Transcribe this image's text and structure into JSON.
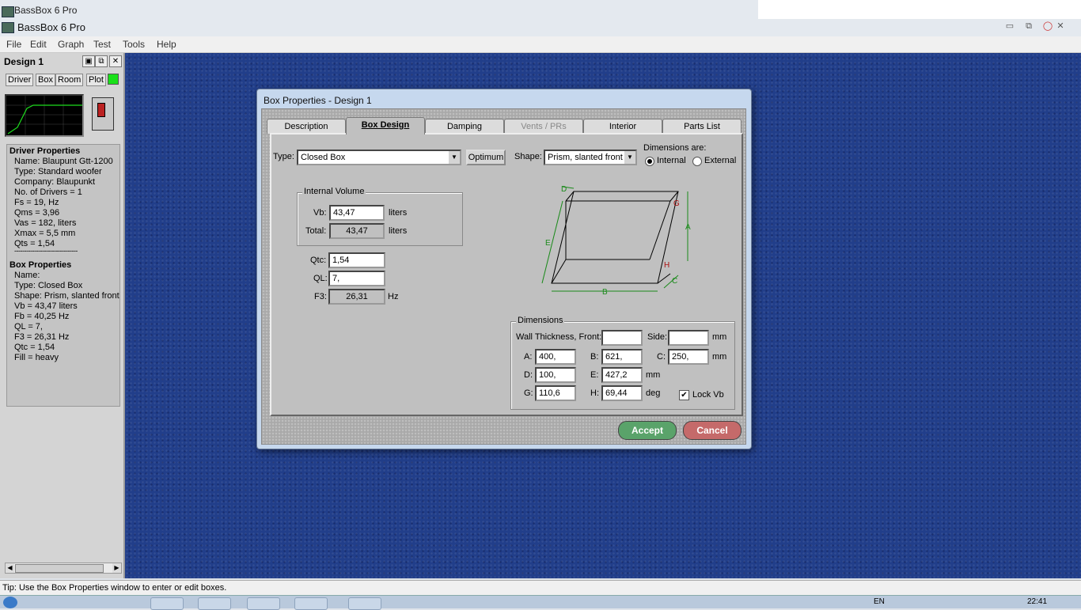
{
  "app": {
    "title_top": "BassBox 6 Pro",
    "title": "BassBox 6 Pro"
  },
  "menu": [
    "File",
    "Edit",
    "Graph",
    "Test",
    "Tools",
    "Help"
  ],
  "left_panel": {
    "title": "Design 1",
    "tabs": [
      "Driver",
      "Box",
      "Room",
      "Plot"
    ],
    "driver_heading": "Driver Properties",
    "driver_lines": [
      "Name: Blaupunt Gtt-1200",
      "Type: Standard woofer",
      "Company: Blaupunkt",
      "No. of Drivers = 1",
      "Fs = 19, Hz",
      "Qms = 3,96",
      "Vas = 182, liters",
      "Xmax = 5,5 mm",
      "Qts = 1,54"
    ],
    "separator": "--------------------------------",
    "box_heading": "Box Properties",
    "box_lines": [
      "Name:",
      "Type: Closed Box",
      "Shape: Prism, slanted front",
      "Vb = 43,47 liters",
      "Fb = 40,25 Hz",
      "QL = 7,",
      "F3 = 26,31 Hz",
      "Qtc = 1,54",
      "Fill = heavy"
    ]
  },
  "status": "Tip: Use the Box Properties window to enter or edit boxes.",
  "dialog": {
    "title": "Box Properties - Design 1",
    "tabs": [
      "Description",
      "Box Design",
      "Damping",
      "Vents / PRs",
      "Interior",
      "Parts List"
    ],
    "type_label": "Type:",
    "type_value": "Closed Box",
    "optimum_label": "Optimum",
    "shape_label": "Shape:",
    "shape_value": "Prism, slanted front",
    "dims_are_label": "Dimensions are:",
    "internal_label": "Internal",
    "external_label": "External",
    "internal_volume": {
      "group_label": "Internal Volume",
      "vb_label": "Vb:",
      "vb_value": "43,47",
      "vb_unit": "liters",
      "total_label": "Total:",
      "total_value": "43,47",
      "total_unit": "liters"
    },
    "qtc_label": "Qtc:",
    "qtc_value": "1,54",
    "ql_label": "QL:",
    "ql_value": "7,",
    "f3_label": "F3:",
    "f3_value": "26,31",
    "f3_unit": "Hz",
    "diagram_letters": [
      "D",
      "G",
      "A",
      "E",
      "H",
      "C",
      "B"
    ],
    "dimensions": {
      "group_label": "Dimensions",
      "wall_label": "Wall Thickness, Front:",
      "wall_front": "",
      "side_label": "Side:",
      "wall_side": "",
      "mm1": "mm",
      "a_label": "A:",
      "a": "400,",
      "b_label": "B:",
      "b": "621,",
      "c_label": "C:",
      "c": "250,",
      "mm2": "mm",
      "d_label": "D:",
      "d": "100,",
      "e_label": "E:",
      "e": "427,2",
      "mm3": "mm",
      "g_label": "G:",
      "g": "110,6",
      "h_label": "H:",
      "h": "69,44",
      "deg": "deg",
      "lock_label": "Lock Vb"
    },
    "accept_label": "Accept",
    "cancel_label": "Cancel"
  },
  "clock": "22:41",
  "lang": "EN"
}
